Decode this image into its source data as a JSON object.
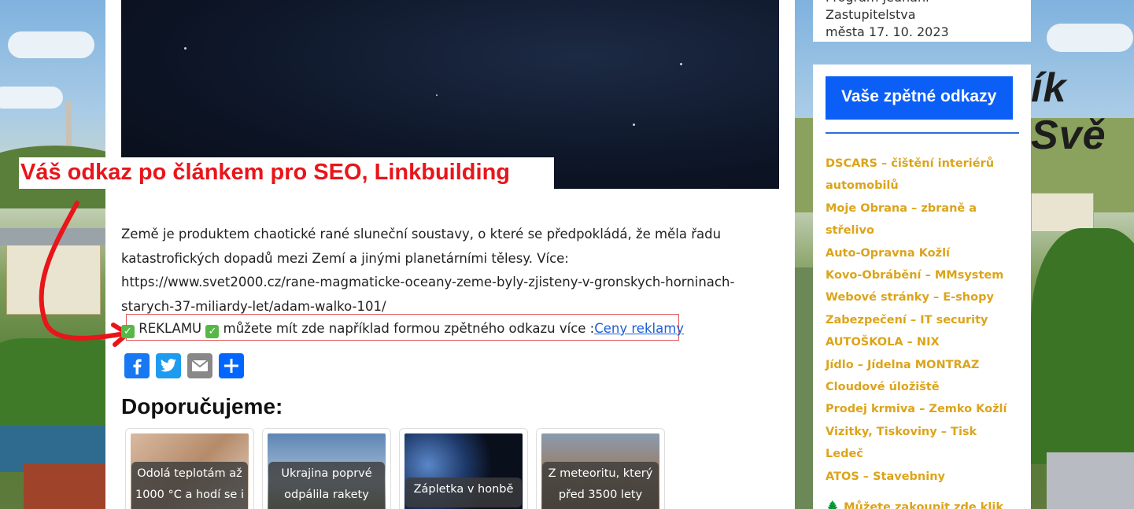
{
  "seo_banner": "Váš odkaz po článkem pro SEO, Linkbuilding",
  "article": {
    "paragraph": "Země je produktem chaotické rané sluneční soustavy, o které se předpokládá, že měla řadu katastrofických dopadů mezi Zemí a jinými planetárními tělesy. Více: https://www.svet2000.cz/rane-magmaticke-oceany-zeme-byly-zjisteny-v-gronskych-horninach-starych-37-miliardy-let/adam-walko-101/",
    "ad_check": "✅",
    "ad_word": "REKLAMU",
    "ad_text": "můžete mít zde například formou zpětného odkazu více :",
    "ad_link": "Ceny reklamy"
  },
  "share": {
    "facebook": "Facebook",
    "twitter": "Twitter",
    "email": "Email",
    "share": "Share"
  },
  "recommend": {
    "title": "Doporučujeme:",
    "cards": [
      {
        "caption": "Odolá teplotám až 1000 °C a hodí se i"
      },
      {
        "caption": "Ukrajina poprvé odpálila rakety"
      },
      {
        "caption": "Zápletka v honbě za"
      },
      {
        "caption": "Z meteoritu, který před 3500 lety"
      }
    ]
  },
  "sidebar": {
    "top_line1": "Program jednání Zastupitelstva",
    "top_line2": "města 17. 10. 2023",
    "widget_title": "Vaše zpětné odkazy",
    "links": [
      "DSCARS – čištění interiérů automobilů",
      "Moje Obrana – zbraně a střelivo",
      "Auto-Opravna Kožlí",
      "Kovo-Obrábění – MMsystem",
      "Webové stránky – E-shopy",
      "Zabezpečení – IT security",
      "AUTOŠKOLA – NIX",
      "Jídlo – Jídelna MONTRAZ",
      "Cloudové úložiště",
      "Prodej krmiva – Zemko Kožlí",
      "Vizitky, Tiskoviny – Tisk Ledeč",
      "ATOS – Stavebniny"
    ],
    "buy_tree": "🌲",
    "buy_text": "Můžete zakoupit zde klik"
  },
  "background_sign": "ík Svě",
  "colors": {
    "accent_blue": "#0b5ff7",
    "link_gold": "#dca41a",
    "banner_red": "#e8151a",
    "ad_link": "#1a5fd6"
  }
}
